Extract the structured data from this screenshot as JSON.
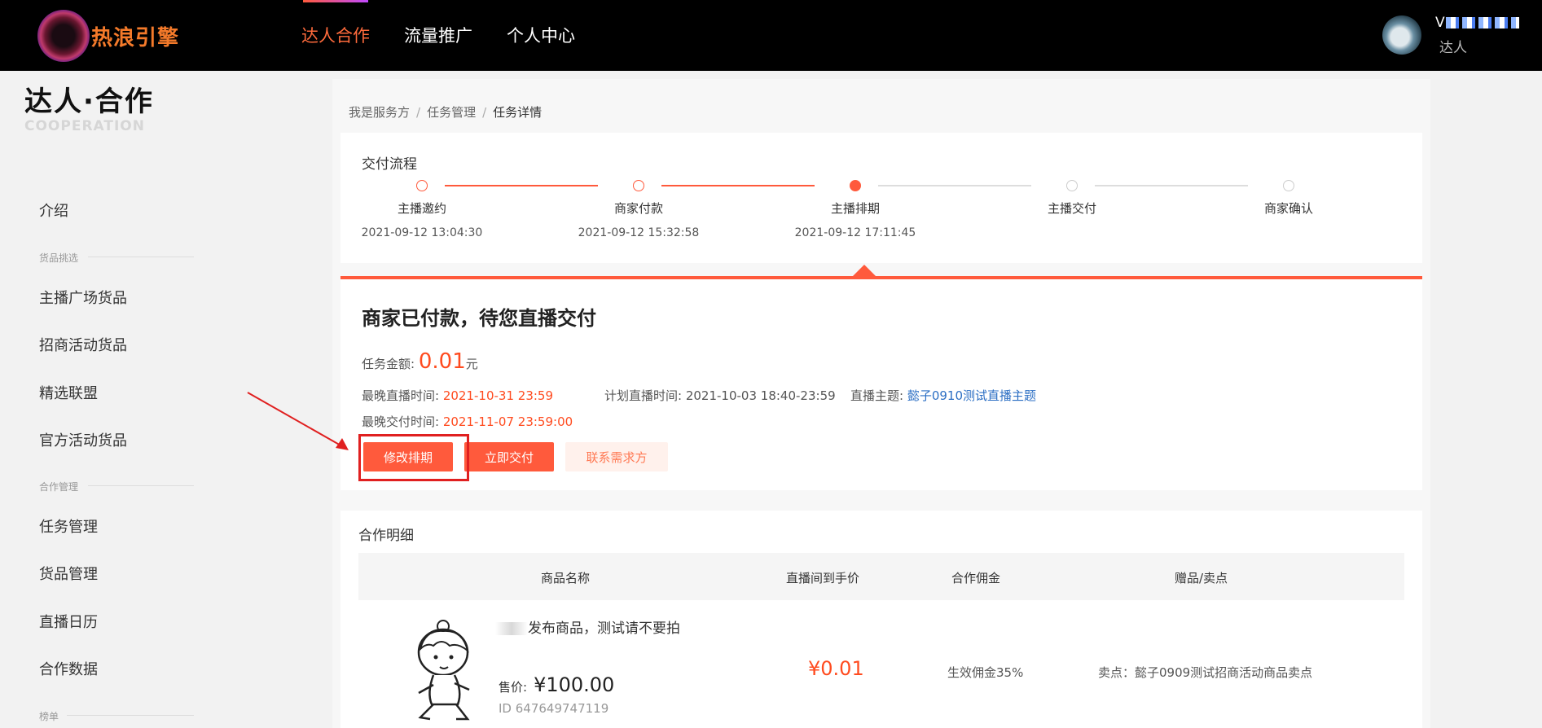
{
  "header": {
    "logo_text": "热浪引擎",
    "nav": [
      "达人合作",
      "流量推广",
      "个人中心"
    ],
    "active_nav": 0,
    "user": {
      "name_prefix": "V",
      "role": "达人"
    }
  },
  "sidebar": {
    "title": "达人·合作",
    "subtitle": "COOPERATION",
    "intro": "介绍",
    "sections": [
      {
        "label": "货品挑选",
        "items": [
          "主播广场货品",
          "招商活动货品",
          "精选联盟",
          "官方活动货品"
        ]
      },
      {
        "label": "合作管理",
        "items": [
          "任务管理",
          "货品管理",
          "直播日历",
          "合作数据"
        ]
      },
      {
        "label": "榜单",
        "items": []
      }
    ]
  },
  "breadcrumb": {
    "items": [
      "我是服务方",
      "任务管理",
      "任务详情"
    ],
    "separator": "/"
  },
  "delivery": {
    "title": "交付流程",
    "steps": [
      {
        "name": "主播邀约",
        "time": "2021-09-12 13:04:30",
        "state": "done"
      },
      {
        "name": "商家付款",
        "time": "2021-09-12 15:32:58",
        "state": "done"
      },
      {
        "name": "主播排期",
        "time": "2021-09-12 17:11:45",
        "state": "current"
      },
      {
        "name": "主播交付",
        "time": "",
        "state": "pending"
      },
      {
        "name": "商家确认",
        "time": "",
        "state": "pending"
      }
    ]
  },
  "status": {
    "heading": "商家已付款，待您直播交付",
    "amount_label": "任务金额:",
    "amount": "0.01",
    "amount_unit": "元",
    "latest_live_label": "最晚直播时间:",
    "latest_live": "2021-10-31 23:59",
    "plan_live_label": "计划直播时间:",
    "plan_live": "2021-10-03 18:40-23:59",
    "topic_label": "直播主题:",
    "topic": "懿子0910测试直播主题",
    "latest_deliver_label": "最晚交付时间:",
    "latest_deliver": "2021-11-07 23:59:00",
    "buttons": {
      "modify": "修改排期",
      "deliver": "立即交付",
      "contact": "联系需求方"
    }
  },
  "detail": {
    "title": "合作明细",
    "columns": [
      "商品名称",
      "直播间到手价",
      "合作佣金",
      "赠品/卖点"
    ],
    "rows": [
      {
        "name": "发布商品，测试请不要拍",
        "price_label": "售价:",
        "price": "¥100.00",
        "id": "ID 647649747119",
        "live_price": "¥0.01",
        "commission": "生效佣金35%",
        "selling_point": "卖点：懿子0909测试招商活动商品卖点"
      }
    ]
  },
  "colors": {
    "accent": "#ff5a3c",
    "link": "#2c6fc4",
    "annotation": "#e02020"
  }
}
